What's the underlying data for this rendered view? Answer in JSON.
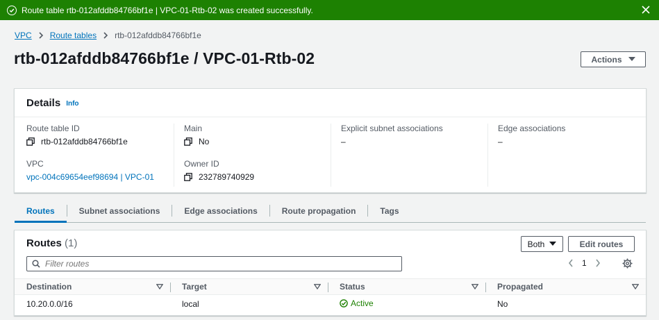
{
  "flash": {
    "message": "Route table rtb-012afddb84766bf1e | VPC-01-Rtb-02 was created successfully."
  },
  "breadcrumb": {
    "items": [
      "VPC",
      "Route tables",
      "rtb-012afddb84766bf1e"
    ]
  },
  "page": {
    "title": "rtb-012afddb84766bf1e / VPC-01-Rtb-02",
    "actions_label": "Actions"
  },
  "details": {
    "title": "Details",
    "info_label": "Info",
    "route_table_id_label": "Route table ID",
    "route_table_id": "rtb-012afddb84766bf1e",
    "main_label": "Main",
    "main": "No",
    "explicit_label": "Explicit subnet associations",
    "explicit": "–",
    "edge_label": "Edge associations",
    "edge": "–",
    "vpc_label": "VPC",
    "vpc": "vpc-004c69654eef98694 | VPC-01",
    "owner_label": "Owner ID",
    "owner": "232789740929"
  },
  "tabs": [
    "Routes",
    "Subnet associations",
    "Edge associations",
    "Route propagation",
    "Tags"
  ],
  "routes": {
    "title": "Routes",
    "count": "(1)",
    "filter_label": "Both",
    "edit_label": "Edit routes",
    "search_placeholder": "Filter routes",
    "page_number": "1",
    "columns": [
      "Destination",
      "Target",
      "Status",
      "Propagated"
    ],
    "rows": [
      {
        "destination": "10.20.0.0/16",
        "target": "local",
        "status": "Active",
        "propagated": "No"
      }
    ]
  },
  "colors": {
    "success": "#1d8102",
    "link": "#0073bb",
    "text": "#16191f"
  }
}
